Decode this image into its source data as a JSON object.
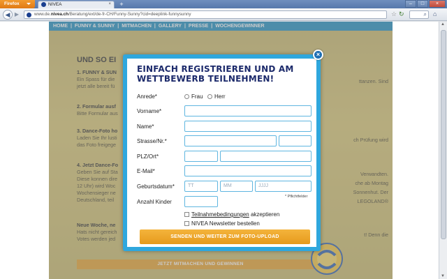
{
  "browser": {
    "app_button": "Firefox",
    "tab_title": "NIVEA",
    "tab_close": "×",
    "new_tab": "+",
    "url_prefix": "www.de.",
    "url_domain": "nivea.ch",
    "url_path": "/Beratung/ext/de-fr-CH/Funny-Sunny?cid=deeplink-funnysunny",
    "window_buttons": [
      "–",
      "□",
      "×"
    ]
  },
  "site": {
    "nav": [
      "HOME",
      "|",
      "FUNNY & SUNNY",
      "|",
      "MITMACHEN",
      "|",
      "GALLERY",
      "|",
      "PRESSE",
      "|",
      "WOCHENGEWINNER"
    ],
    "heading": "UND SO EI",
    "blocks": [
      {
        "h": "1. FUNNY & SUN",
        "lines": [
          "Ein Spass für die",
          "jetzt alle bereit fü"
        ]
      },
      {
        "h": "2. Formular ausf",
        "lines": [
          "Bitte Formular aus"
        ]
      },
      {
        "h": "3. Dance-Foto ho",
        "lines": [
          "Laden Sie Ihr lusti",
          "das Foto freigege"
        ]
      },
      {
        "h": "4. Jetzt Dance-Fo",
        "lines": [
          "Geben Sie auf Sta",
          "Diese konnen dire",
          "12 Uhr) wird Woc",
          "Wochensieger ne",
          "Deutschland, teil"
        ]
      },
      {
        "h": "Neue Woche, ne",
        "lines": [
          "Hats nicht gereich",
          "Votes werden jed"
        ]
      }
    ],
    "right_fragments": [
      "ttanzen. Sind",
      "ch Prüfung wird",
      "Verwandten.",
      "che ab Montag",
      "Sonnenhut. Der",
      "LEGOLAND®",
      "t! Denn die"
    ],
    "bottom_button": "JETZT MITMACHEN UND GEWINNEN"
  },
  "modal": {
    "close": "×",
    "title": "EINFACH REGISTRIEREN UND AM WETTBEWERB TEILNEHMEN!",
    "fields": {
      "anrede": "Anrede*",
      "frau": "Frau",
      "herr": "Herr",
      "vorname": "Vorname*",
      "name": "Name*",
      "strasse": "Strasse/Nr.*",
      "plz": "PLZ/Ort*",
      "email": "E-Mail*",
      "geburtsdatum": "Geburtsdatum*",
      "anzahl_kinder": "Anzahl Kinder"
    },
    "placeholders": {
      "day": "TT",
      "month": "MM",
      "year": "JJJJ"
    },
    "required_note": "* Pflichtfelder",
    "terms_link": "Teilnahmebedingungen",
    "terms_suffix": " akzeptieren",
    "newsletter": "NIVEA Newsletter bestellen",
    "submit": "SENDEN UND WEITER ZUM FOTO-UPLOAD"
  },
  "colors": {
    "accent": "#2fa7dd",
    "button": "#e69a1c",
    "title": "#1c2a6b"
  }
}
